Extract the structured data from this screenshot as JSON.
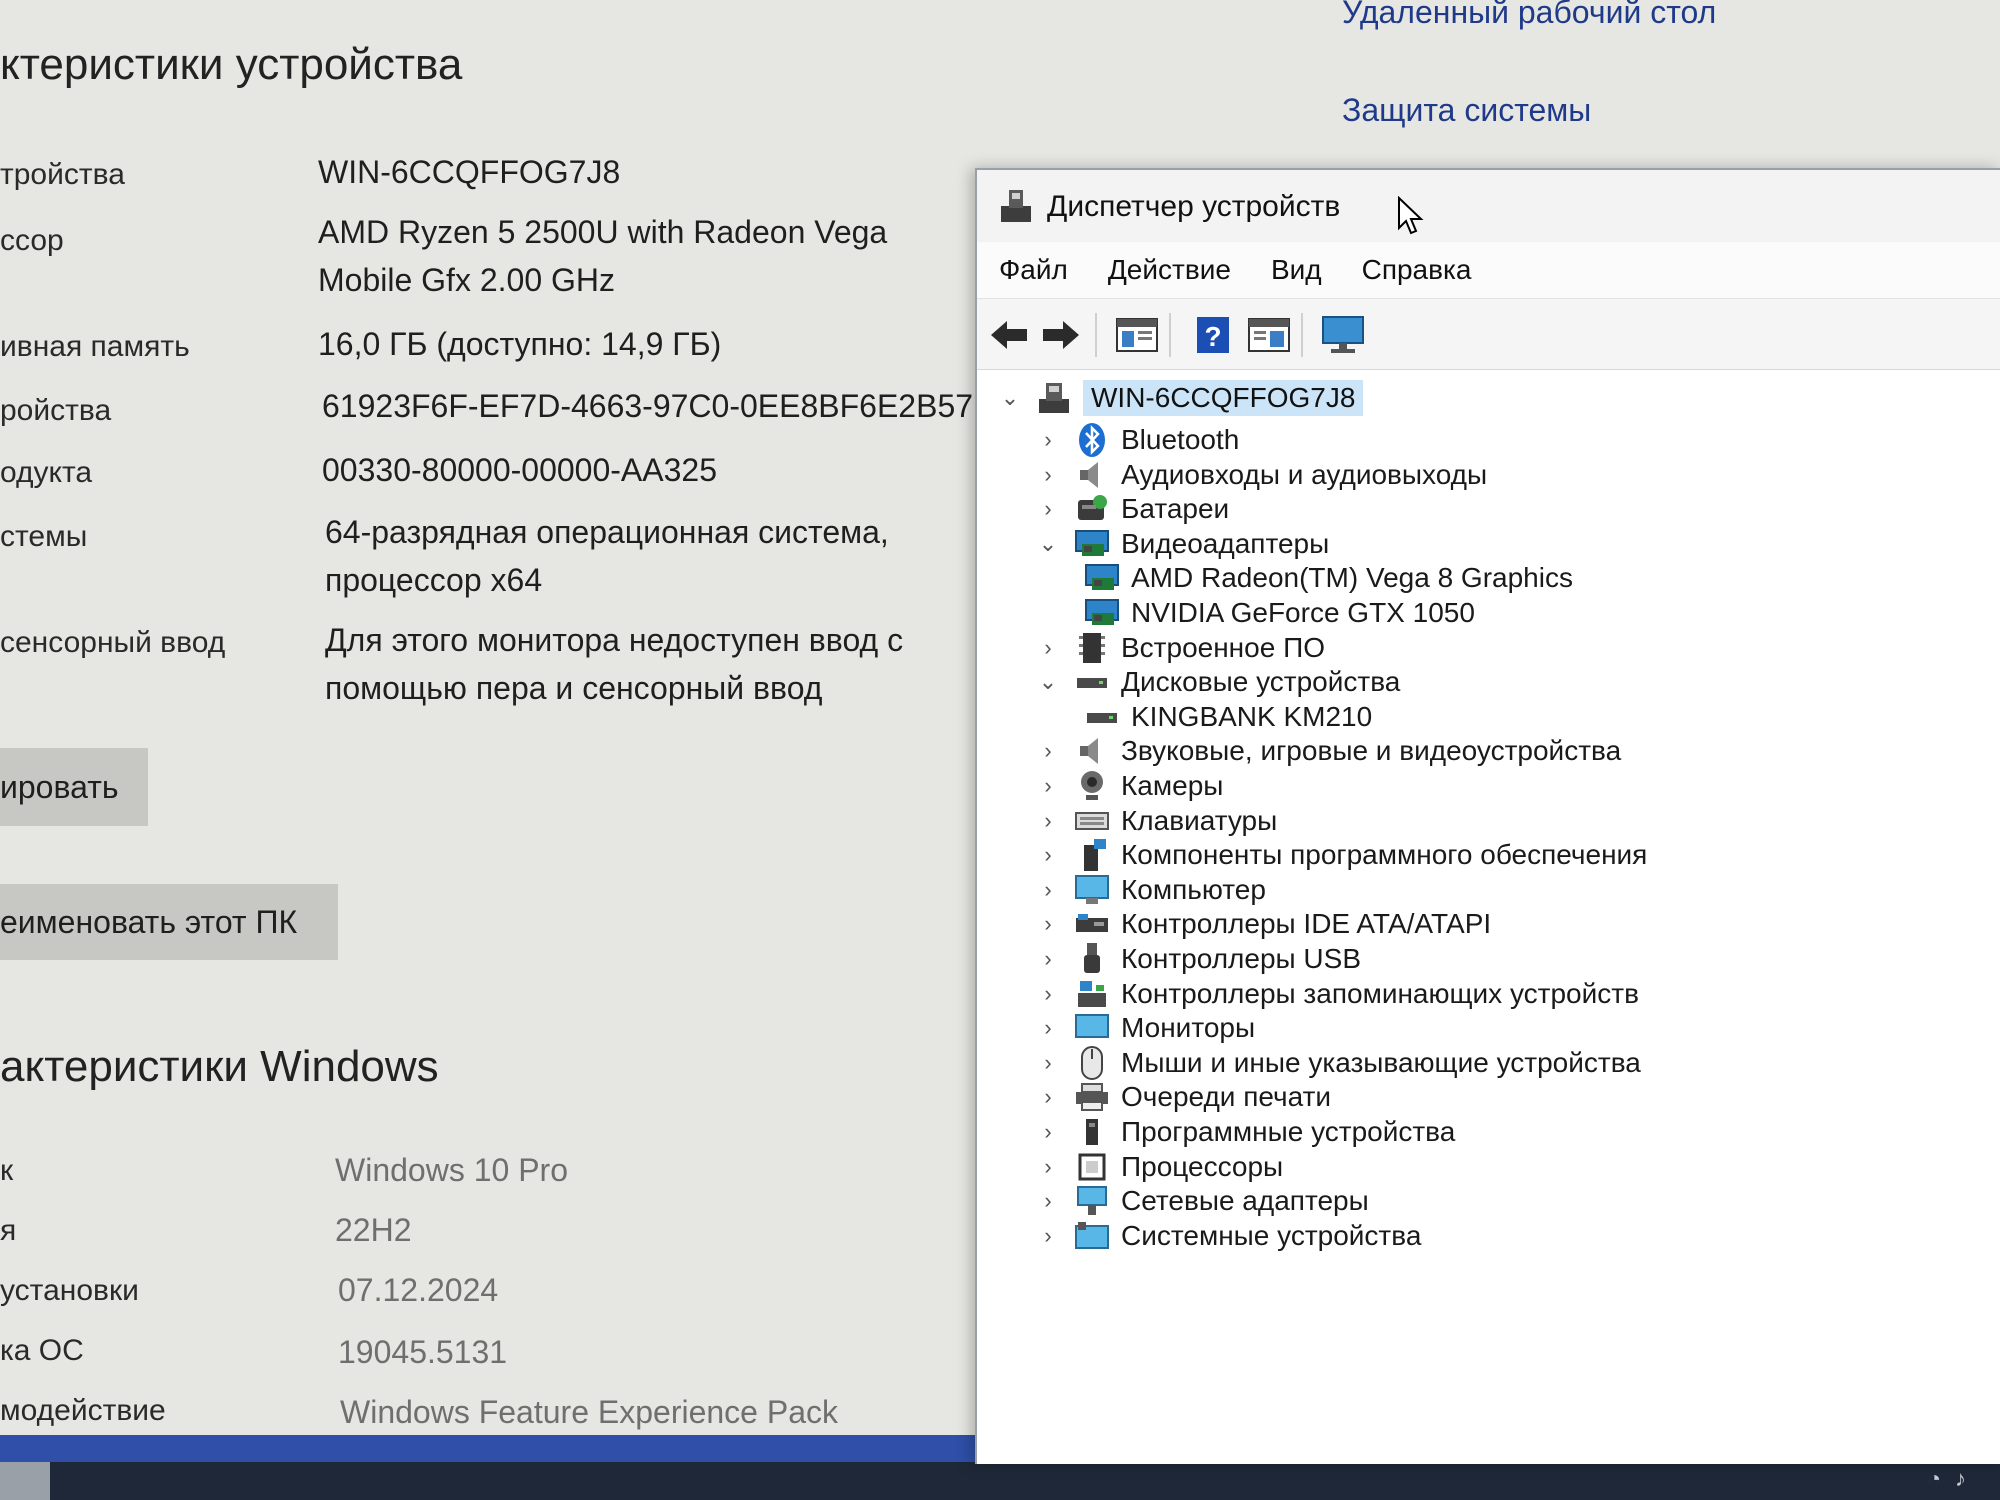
{
  "about": {
    "device_heading": "ктеристики устройства",
    "rows": [
      {
        "label": "тройства",
        "value": "WIN-6CCQFFOG7J8"
      },
      {
        "label": "ссор",
        "value": "AMD Ryzen 5 2500U with Radeon Vega",
        "value2": "Mobile Gfx     2.00 GHz"
      },
      {
        "label": "ивная память",
        "value": "16,0 ГБ (доступно: 14,9 ГБ)"
      },
      {
        "label": "ройства",
        "value": "61923F6F-EF7D-4663-97C0-0EE8BF6E2B57"
      },
      {
        "label": "одукта",
        "value": "00330-80000-00000-AA325"
      },
      {
        "label": "стемы",
        "value": "64-разрядная операционная система,",
        "value2": "процессор x64"
      },
      {
        "label": " сенсорный ввод",
        "value": "Для этого монитора недоступен ввод с",
        "value2": "помощью пера и сенсорный ввод"
      }
    ],
    "copy_button": "ировать",
    "rename_button": "еименовать этот ПК",
    "windows_heading": "актеристики Windows",
    "win_rows": [
      {
        "label": "к",
        "value": "Windows 10 Pro"
      },
      {
        "label": "я",
        "value": "22H2"
      },
      {
        "label": "установки",
        "value": "07.12.2024"
      },
      {
        "label": "ка ОС",
        "value": "19045.5131"
      },
      {
        "label": "модействие",
        "value": "Windows Feature Experience Pack"
      }
    ],
    "links": {
      "remote_desktop": "Удаленный рабочий стол",
      "system_protection": "Защита системы"
    }
  },
  "devmgr": {
    "title": "Диспетчер устройств",
    "menu": [
      "Файл",
      "Действие",
      "Вид",
      "Справка"
    ],
    "root": "WIN-6CCQFFOG7J8",
    "items": [
      {
        "label": "Bluetooth",
        "icon": "bluetooth-icon",
        "state": "collapsed",
        "level": 1
      },
      {
        "label": "Аудиовходы и аудиовыходы",
        "icon": "speaker-icon",
        "state": "collapsed",
        "level": 1
      },
      {
        "label": "Батареи",
        "icon": "battery-icon",
        "state": "collapsed",
        "level": 1
      },
      {
        "label": "Видеоадаптеры",
        "icon": "display-adapter-icon",
        "state": "expanded",
        "level": 1
      },
      {
        "label": "AMD Radeon(TM) Vega 8 Graphics",
        "icon": "display-adapter-icon",
        "state": "none",
        "level": 2
      },
      {
        "label": "NVIDIA GeForce GTX 1050",
        "icon": "display-adapter-icon",
        "state": "none",
        "level": 2
      },
      {
        "label": "Встроенное ПО",
        "icon": "firmware-icon",
        "state": "collapsed",
        "level": 1
      },
      {
        "label": "Дисковые устройства",
        "icon": "disk-icon",
        "state": "expanded",
        "level": 1
      },
      {
        "label": "KINGBANK KM210",
        "icon": "disk-icon",
        "state": "none",
        "level": 2
      },
      {
        "label": "Звуковые, игровые и видеоустройства",
        "icon": "speaker-icon",
        "state": "collapsed",
        "level": 1
      },
      {
        "label": "Камеры",
        "icon": "camera-icon",
        "state": "collapsed",
        "level": 1
      },
      {
        "label": "Клавиатуры",
        "icon": "keyboard-icon",
        "state": "collapsed",
        "level": 1
      },
      {
        "label": "Компоненты программного обеспечения",
        "icon": "software-component-icon",
        "state": "collapsed",
        "level": 1
      },
      {
        "label": "Компьютер",
        "icon": "computer-icon",
        "state": "collapsed",
        "level": 1
      },
      {
        "label": "Контроллеры IDE ATA/ATAPI",
        "icon": "ide-controller-icon",
        "state": "collapsed",
        "level": 1
      },
      {
        "label": "Контроллеры USB",
        "icon": "usb-icon",
        "state": "collapsed",
        "level": 1
      },
      {
        "label": "Контроллеры запоминающих устройств",
        "icon": "storage-controller-icon",
        "state": "collapsed",
        "level": 1
      },
      {
        "label": "Мониторы",
        "icon": "monitor-icon",
        "state": "collapsed",
        "level": 1
      },
      {
        "label": "Мыши и иные указывающие устройства",
        "icon": "mouse-icon",
        "state": "collapsed",
        "level": 1
      },
      {
        "label": "Очереди печати",
        "icon": "printer-icon",
        "state": "collapsed",
        "level": 1
      },
      {
        "label": "Программные устройства",
        "icon": "software-device-icon",
        "state": "collapsed",
        "level": 1
      },
      {
        "label": "Процессоры",
        "icon": "processor-icon",
        "state": "collapsed",
        "level": 1
      },
      {
        "label": "Сетевые адаптеры",
        "icon": "network-adapter-icon",
        "state": "collapsed",
        "level": 1
      },
      {
        "label": "Системные устройства",
        "icon": "system-device-icon",
        "state": "collapsed",
        "level": 1
      }
    ]
  },
  "colors": {
    "accent": "#1f3a8a",
    "selection": "#cce4f7",
    "taskbar": "#1f2838"
  }
}
